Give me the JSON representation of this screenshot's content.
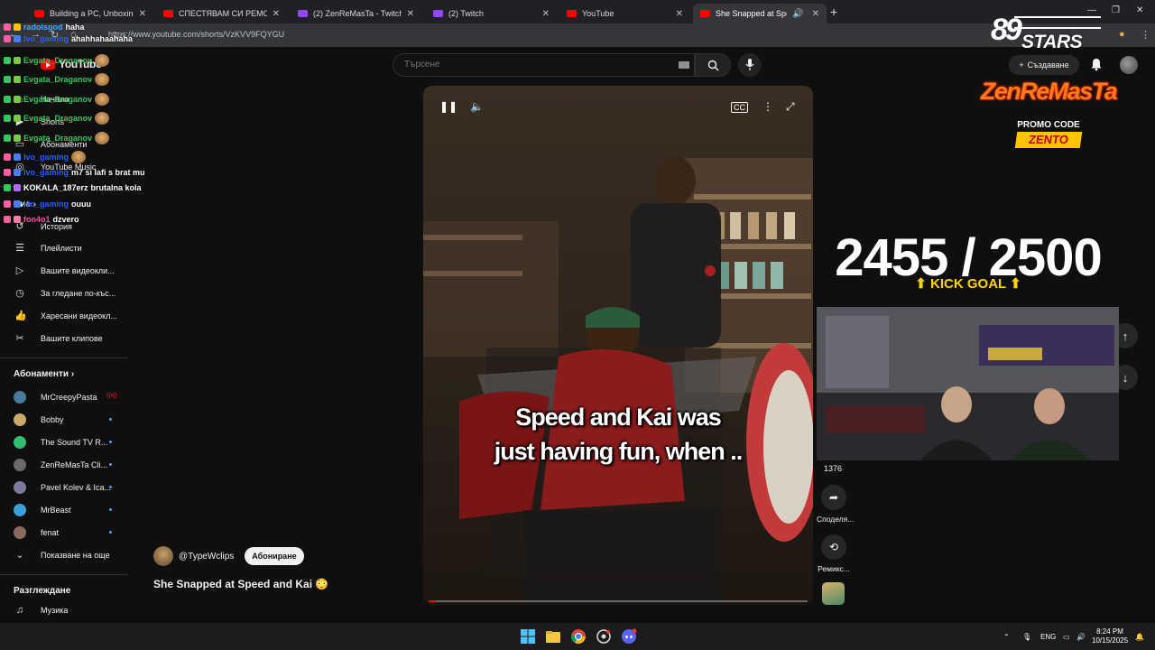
{
  "browser": {
    "tabs": [
      {
        "label": "Building a PC, Unboxing the",
        "active": false,
        "favicon_color": "#ff0000"
      },
      {
        "label": "СПЕСТЯВАМ СИ РЕМОНТ ЗА 3",
        "active": false,
        "favicon_color": "#ff0000"
      },
      {
        "label": "(2) ZenReMasTa - Twitch",
        "active": false,
        "favicon_color": "#9146ff"
      },
      {
        "label": "(2) Twitch",
        "active": false,
        "favicon_color": "#9146ff"
      },
      {
        "label": "YouTube",
        "active": false,
        "favicon_color": "#ff0000"
      },
      {
        "label": "She Snapped at Speed and",
        "active": true,
        "favicon_color": "#ff0000"
      }
    ],
    "url": "https://www.youtube.com/shorts/VzKVV9FQYGU"
  },
  "youtube": {
    "logo": "YouTube",
    "search_placeholder": "Търсене",
    "create_label": "Създаване",
    "sidebar": {
      "items": [
        {
          "label": "Начало",
          "icon": "home-icon"
        },
        {
          "label": "Shorts",
          "icon": "shorts-icon"
        },
        {
          "label": "Абонаменти",
          "icon": "subscriptions-icon"
        },
        {
          "label": "YouTube Music",
          "icon": "music-icon"
        }
      ],
      "you_heading": "Вие",
      "you_items": [
        {
          "label": "История",
          "icon": "history-icon"
        },
        {
          "label": "Плейлисти",
          "icon": "playlist-icon"
        },
        {
          "label": "Вашите видеокли...",
          "icon": "video-icon"
        },
        {
          "label": "За гледане по-къс...",
          "icon": "clock-icon"
        },
        {
          "label": "Харесани видеокл...",
          "icon": "like-icon"
        },
        {
          "label": "Вашите клипове",
          "icon": "scissors-icon"
        }
      ],
      "subs_heading": "Абонаменти",
      "subscriptions": [
        {
          "label": "MrCreepyPasta",
          "color": "#4a7a9a",
          "live": true
        },
        {
          "label": "Bobby",
          "color": "#c9a86a",
          "live": false
        },
        {
          "label": "The Sound TV R...",
          "color": "#2fbf71",
          "live": false
        },
        {
          "label": "ZenReMasTa Cli...",
          "color": "#6a6a6a",
          "live": false
        },
        {
          "label": "Pavel Kolev & Ica...",
          "color": "#7a7a9a",
          "live": false
        },
        {
          "label": "MrBeast",
          "color": "#3aa0d8",
          "live": false
        },
        {
          "label": "fenat",
          "color": "#8a6a5a",
          "live": false
        }
      ],
      "show_more": "Показване на още",
      "explore_heading": "Разглеждане",
      "explore_items": [
        {
          "label": "Музика",
          "icon": "music-note-icon"
        }
      ]
    },
    "video": {
      "caption_line1": "Speed and Kai was",
      "caption_line2": "just having fun, when ..",
      "progress": 0.02
    },
    "channel": {
      "handle": "@TypeWclips",
      "subscribe_label": "Абониране"
    },
    "title": "She Snapped at Speed and Kai 😳",
    "actions": {
      "likes": "1376",
      "share": "Споделя...",
      "remix": "Ремикс..."
    }
  },
  "chat": [
    {
      "user": "radoisgod",
      "user_color": "#4aa3ff",
      "msg": "haha"
    },
    {
      "user": "Ivo_gaming",
      "user_color": "#2c5bff",
      "msg": "ahahhahaahaha"
    },
    {
      "user": "Evgata_Draganov",
      "user_color": "#34c759",
      "msg": ""
    },
    {
      "user": "Evgata_Draganov",
      "user_color": "#34c759",
      "msg": ""
    },
    {
      "user": "Evgata_Draganov",
      "user_color": "#34c759",
      "msg": ""
    },
    {
      "user": "Evgata_Draganov",
      "user_color": "#34c759",
      "msg": ""
    },
    {
      "user": "Evgata_Draganov",
      "user_color": "#34c759",
      "msg": ""
    },
    {
      "user": "Ivo_gaming",
      "user_color": "#2c5bff",
      "msg": ""
    },
    {
      "user": "Ivo_gaming",
      "user_color": "#2c5bff",
      "msg": "m7 si lafi s brat mu"
    },
    {
      "user": "KOKALA_187erz",
      "user_color": "#ffffff",
      "msg": "brutalna kola"
    },
    {
      "user": "Ivo_gaming",
      "user_color": "#2c5bff",
      "msg": "ouuu"
    },
    {
      "user": "fon4o1",
      "user_color": "#ff4fa3",
      "msg": "dzvero"
    }
  ],
  "overlay": {
    "stars_num": "89",
    "stars_word": "STARS",
    "brand": "ZenReMasTa",
    "promo": "PROMO CODE",
    "code": "ZENTO",
    "goal": "2455 / 2500",
    "goal_label": "KICK GOAL"
  },
  "taskbar": {
    "lang": "ENG",
    "time": "8:24 PM",
    "date": "10/15/2025"
  },
  "colors": {
    "accent": "#ff0000",
    "bg": "#0f0f0f",
    "goal": "#ffd400"
  }
}
